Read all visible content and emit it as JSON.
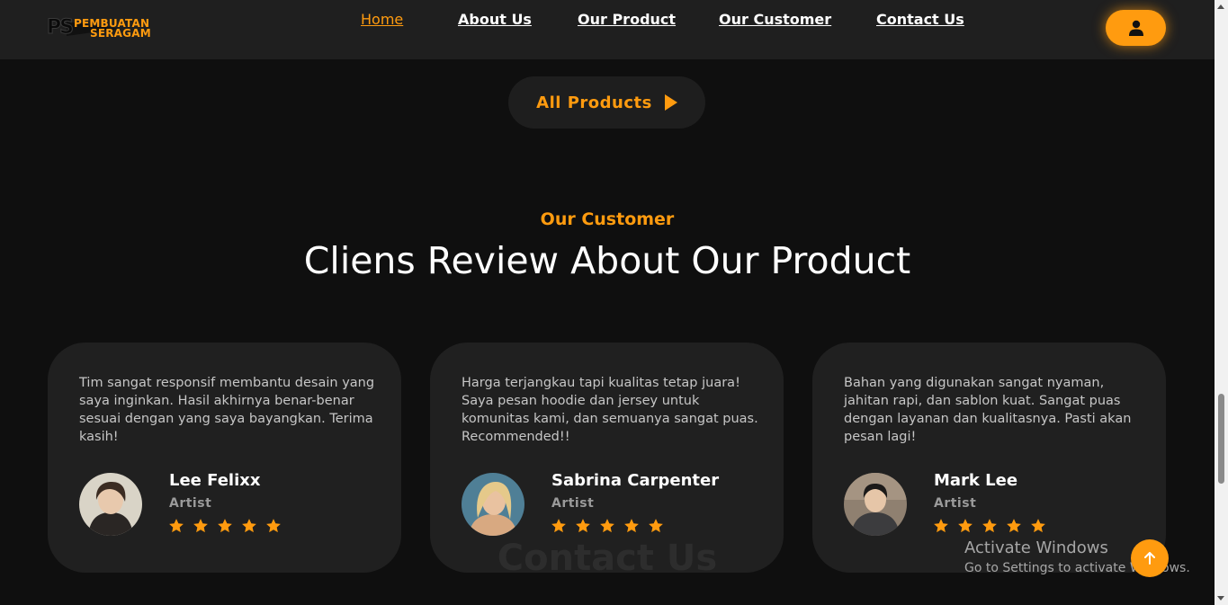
{
  "brand": {
    "logo_mark": "PS",
    "logo_line1": "PEMBUATAN",
    "logo_line2": "SERAGAM",
    "accent_color": "#ff9b0f"
  },
  "nav": {
    "items": [
      {
        "label": "Home",
        "active": true
      },
      {
        "label": "About Us",
        "active": false
      },
      {
        "label": "Our Product",
        "active": false
      },
      {
        "label": "Our Customer",
        "active": false
      },
      {
        "label": "Contact Us",
        "active": false
      }
    ],
    "user_icon": "user-icon"
  },
  "all_products": {
    "label": "All Products",
    "icon": "play-icon"
  },
  "customer_section": {
    "subtitle": "Our Customer",
    "title": "Cliens Review About Our Product"
  },
  "reviews": [
    {
      "text": "Tim sangat responsif membantu desain yang saya inginkan. Hasil akhirnya benar-benar sesuai dengan yang saya bayangkan. Terima kasih!",
      "name": "Lee Felixx",
      "role": "Artist",
      "rating": 5
    },
    {
      "text": "Harga terjangkau tapi kualitas tetap juara! Saya pesan hoodie dan jersey untuk komunitas kami, dan semuanya sangat puas. Recommended!!",
      "name": "Sabrina Carpenter",
      "role": "Artist",
      "rating": 5
    },
    {
      "text": "Bahan yang digunakan sangat nyaman, jahitan rapi, dan sablon kuat. Sangat puas dengan layanan dan kualitasnya. Pasti akan pesan lagi!",
      "name": "Mark Lee",
      "role": "Artist",
      "rating": 5
    }
  ],
  "next_section_title": "Contact Us",
  "scroll_top_icon": "arrow-up-icon",
  "os_watermark": {
    "line1": "Activate Windows",
    "line2": "Go to Settings to activate Windows."
  }
}
